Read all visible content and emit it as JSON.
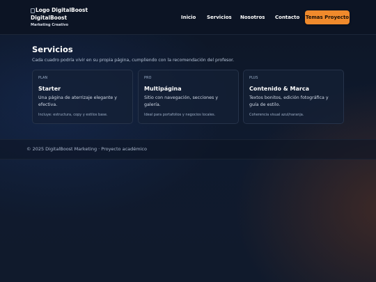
{
  "header": {
    "logo_alt": "Logo DigitalBoost",
    "brand_name": "DigitalBoost",
    "tagline": "Marketing Creativo",
    "nav": [
      {
        "label": "Inicio"
      },
      {
        "label": "Servicios"
      },
      {
        "label": "Nosotros"
      },
      {
        "label": "Contacto"
      }
    ],
    "cta_label": "Temas Proyecto"
  },
  "services": {
    "title": "Servicios",
    "description": "Cada cuadro podría vivir en su propia página, cumpliendo con la recomendación del profesor.",
    "cards": [
      {
        "tier": "PLAN",
        "title": "Starter",
        "description": "Una página de aterrizaje elegante y efectiva.",
        "note": "Incluye: estructura, copy y estilos base."
      },
      {
        "tier": "PRO",
        "title": "Multipágina",
        "description": "Sitio con navegación, secciones y galería.",
        "note": "Ideal para portafolios y negocios locales."
      },
      {
        "tier": "PLUS",
        "title": "Contenido & Marca",
        "description": "Textos bonitos, edición fotográfica y guía de estilo.",
        "note": "Coherencia visual azul/naranja."
      }
    ]
  },
  "footer": {
    "text": "© 2025 DigitalBoost Marketing · Proyecto académico"
  },
  "colors": {
    "accent": "#f08a2c",
    "background": "#0f1a2e",
    "card_border": "#26334a"
  }
}
